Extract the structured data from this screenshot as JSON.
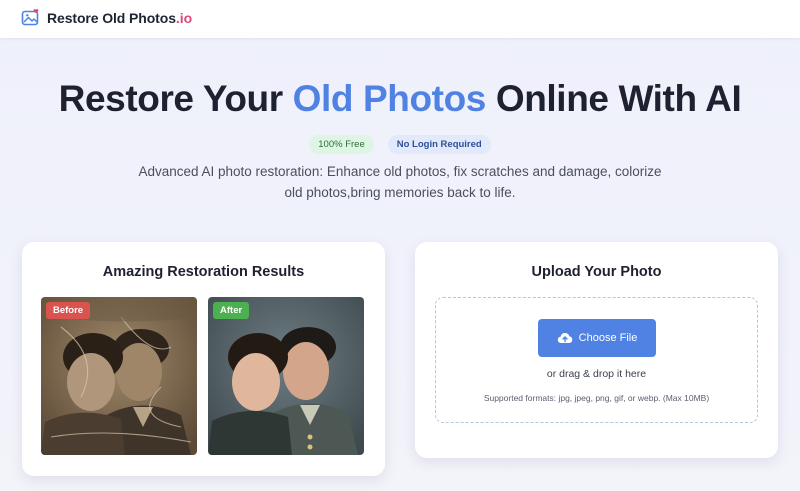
{
  "header": {
    "brand_name": "Restore Old Photos",
    "brand_tld": ".io",
    "brand_icon": "photo-heart-icon"
  },
  "hero": {
    "title_pre": "Restore Your ",
    "title_accent": "Old Photos",
    "title_post": " Online With AI",
    "badges": [
      "100% Free",
      "No Login Required"
    ],
    "subtitle": "Advanced AI photo restoration: Enhance old photos, fix scratches and damage, colorize old photos,bring memories back to life."
  },
  "results": {
    "title": "Amazing Restoration Results",
    "before_label": "Before",
    "after_label": "After"
  },
  "upload": {
    "title": "Upload Your Photo",
    "button_label": "Choose File",
    "button_icon": "cloud-upload-icon",
    "drag_text": "or drag & drop it here",
    "formats_text": "Supported formats: jpg, jpeg, png, gif, or webp. (Max 10MB)"
  },
  "colors": {
    "accent": "#4f82e3",
    "brand_tld": "#e0457b",
    "before_tag": "#d9534f",
    "after_tag": "#4caf50"
  }
}
